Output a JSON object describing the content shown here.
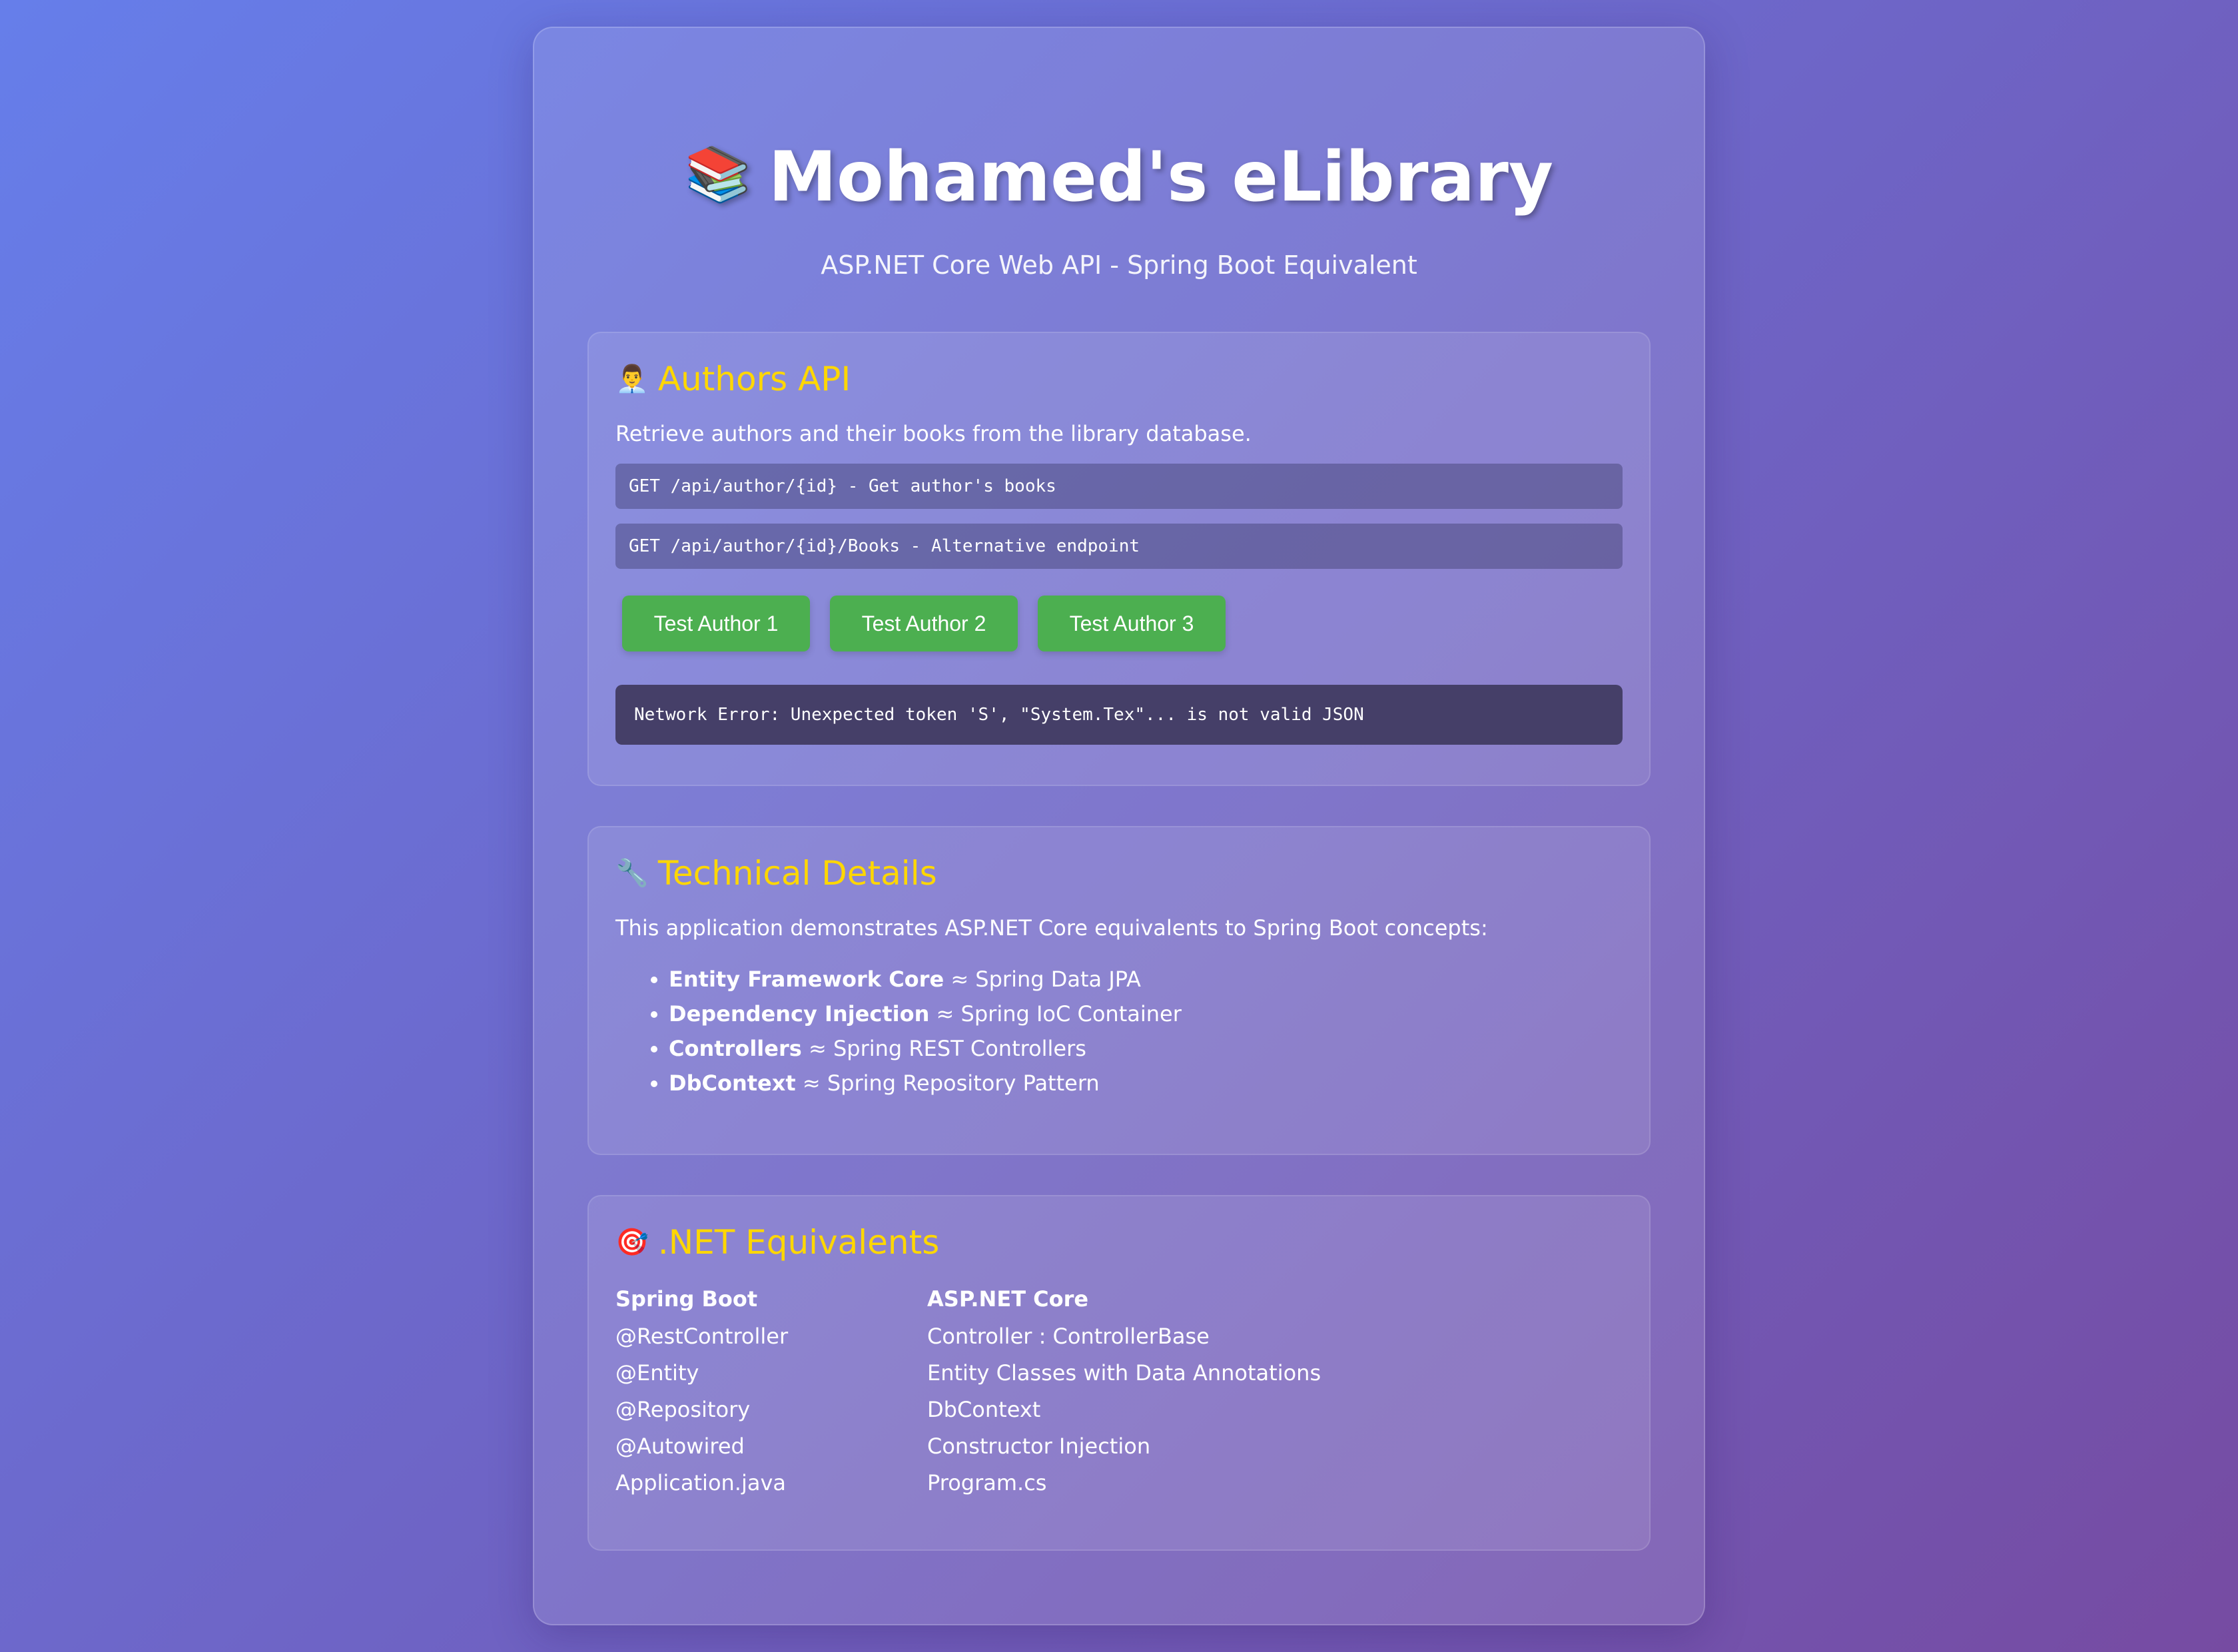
{
  "header": {
    "logo_emoji": "📚",
    "title": "Mohamed's eLibrary",
    "subtitle": "ASP.NET Core Web API - Spring Boot Equivalent"
  },
  "authors_api": {
    "icon": "👨‍💼",
    "title": "Authors API",
    "description": "Retrieve authors and their books from the library database.",
    "endpoints": [
      "GET /api/author/{id} - Get author's books",
      "GET /api/author/{id}/Books - Alternative endpoint"
    ],
    "buttons": [
      "Test Author 1",
      "Test Author 2",
      "Test Author 3"
    ],
    "result": "Network Error: Unexpected token 'S', \"System.Tex\"... is not valid JSON"
  },
  "technical": {
    "icon": "🔧",
    "title": "Technical Details",
    "description": "This application demonstrates ASP.NET Core equivalents to Spring Boot concepts:",
    "items": [
      {
        "term": "Entity Framework Core",
        "rest": " ≈ Spring Data JPA"
      },
      {
        "term": "Dependency Injection",
        "rest": " ≈ Spring IoC Container"
      },
      {
        "term": "Controllers",
        "rest": " ≈ Spring REST Controllers"
      },
      {
        "term": "DbContext",
        "rest": " ≈ Spring Repository Pattern"
      }
    ]
  },
  "equivalents": {
    "icon": "🎯",
    "title": ".NET Equivalents",
    "headers": [
      "Spring Boot",
      "ASP.NET Core"
    ],
    "rows": [
      [
        "@RestController",
        "Controller : ControllerBase"
      ],
      [
        "@Entity",
        "Entity Classes with Data Annotations"
      ],
      [
        "@Repository",
        "DbContext"
      ],
      [
        "@Autowired",
        "Constructor Injection"
      ],
      [
        "Application.java",
        "Program.cs"
      ]
    ]
  },
  "colors": {
    "background_start": "#667eea",
    "background_end": "#764ba2",
    "heading_accent": "#ffd700",
    "button": "#4caf50"
  }
}
